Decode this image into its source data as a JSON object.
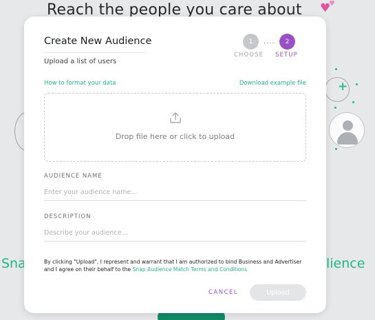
{
  "background": {
    "heading": "Reach the people you care about",
    "heart_icon": "heart-icon",
    "left_text": "Sna",
    "right_text": "lience",
    "accent_color": "#1fb986"
  },
  "modal": {
    "title": "Create New Audience",
    "subtitle": "Upload a list of users",
    "steps": [
      {
        "number": "1",
        "label": "CHOOSE",
        "state": "complete",
        "color": "#c5c7cb"
      },
      {
        "number": "2",
        "label": "SETUP",
        "state": "active",
        "color": "#9b4fc5"
      }
    ],
    "step_connector": "....",
    "links": {
      "format": "How to format your data",
      "download": "Download example file"
    },
    "dropzone": {
      "icon": "upload-icon",
      "text": "Drop file here or click to upload"
    },
    "fields": {
      "name": {
        "label": "AUDIENCE NAME",
        "placeholder": "Enter your audience name...",
        "value": ""
      },
      "description": {
        "label": "DESCRIPTION",
        "placeholder": "Describe your audience...",
        "value": ""
      }
    },
    "terms": {
      "text": "By clicking \"Upload\", I represent and warrant that I am authorized to bind Business and Advertiser and I agree on their behalf to the ",
      "link": "Snap Audience Match Terms and Conditions"
    },
    "buttons": {
      "cancel": "CANCEL",
      "upload": "Upload"
    },
    "colors": {
      "brand_purple": "#9b4fc5",
      "link_green": "#1fb986",
      "disabled": "#e3e5e7"
    }
  }
}
